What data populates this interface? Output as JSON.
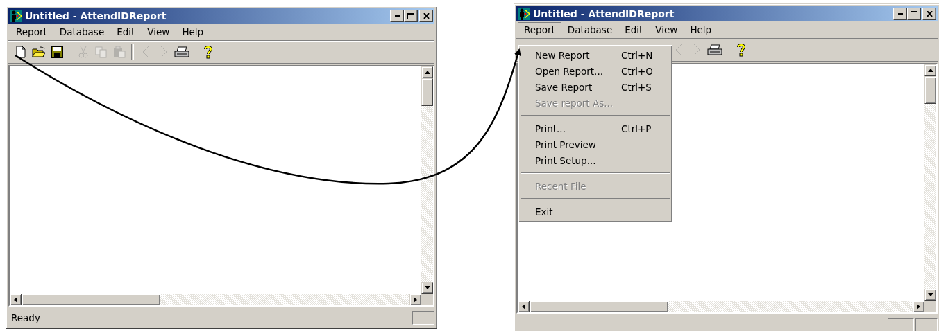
{
  "windows": [
    {
      "title": "Untitled - AttendIDReport",
      "menu": [
        {
          "label": "Report",
          "selected": false
        },
        {
          "label": "Database",
          "selected": false
        },
        {
          "label": "Edit",
          "selected": false
        },
        {
          "label": "View",
          "selected": false
        },
        {
          "label": "Help",
          "selected": false
        }
      ],
      "toolbar": [
        {
          "kind": "new",
          "disabled": false
        },
        {
          "kind": "open",
          "disabled": false
        },
        {
          "kind": "save",
          "disabled": false
        },
        {
          "kind": "sep"
        },
        {
          "kind": "cut",
          "disabled": true
        },
        {
          "kind": "copy",
          "disabled": true
        },
        {
          "kind": "paste",
          "disabled": true
        },
        {
          "kind": "sep"
        },
        {
          "kind": "back",
          "disabled": true
        },
        {
          "kind": "forward",
          "disabled": true
        },
        {
          "kind": "print",
          "disabled": false
        },
        {
          "kind": "sep"
        },
        {
          "kind": "help",
          "disabled": false
        }
      ],
      "status": "Ready"
    },
    {
      "title": "Untitled - AttendIDReport",
      "menu": [
        {
          "label": "Report",
          "selected": true
        },
        {
          "label": "Database",
          "selected": false
        },
        {
          "label": "Edit",
          "selected": false
        },
        {
          "label": "View",
          "selected": false
        },
        {
          "label": "Help",
          "selected": false
        }
      ],
      "toolbar": [
        {
          "kind": "back",
          "disabled": true
        },
        {
          "kind": "forward",
          "disabled": true
        },
        {
          "kind": "print",
          "disabled": false
        },
        {
          "kind": "sep"
        },
        {
          "kind": "help",
          "disabled": false
        }
      ],
      "dropdown": [
        {
          "kind": "item",
          "label": "New Report",
          "shortcut": "Ctrl+N",
          "disabled": false
        },
        {
          "kind": "item",
          "label": "Open Report...",
          "shortcut": "Ctrl+O",
          "disabled": false
        },
        {
          "kind": "item",
          "label": "Save Report",
          "shortcut": "Ctrl+S",
          "disabled": false
        },
        {
          "kind": "item",
          "label": "Save report As...",
          "disabled": true
        },
        {
          "kind": "separator"
        },
        {
          "kind": "item",
          "label": "Print...",
          "shortcut": "Ctrl+P",
          "disabled": false
        },
        {
          "kind": "item",
          "label": "Print Preview",
          "disabled": false
        },
        {
          "kind": "item",
          "label": "Print Setup...",
          "disabled": false
        },
        {
          "kind": "separator"
        },
        {
          "kind": "item",
          "label": "Recent File",
          "disabled": true
        },
        {
          "kind": "separator"
        },
        {
          "kind": "item",
          "label": "Exit",
          "disabled": false
        }
      ]
    }
  ]
}
